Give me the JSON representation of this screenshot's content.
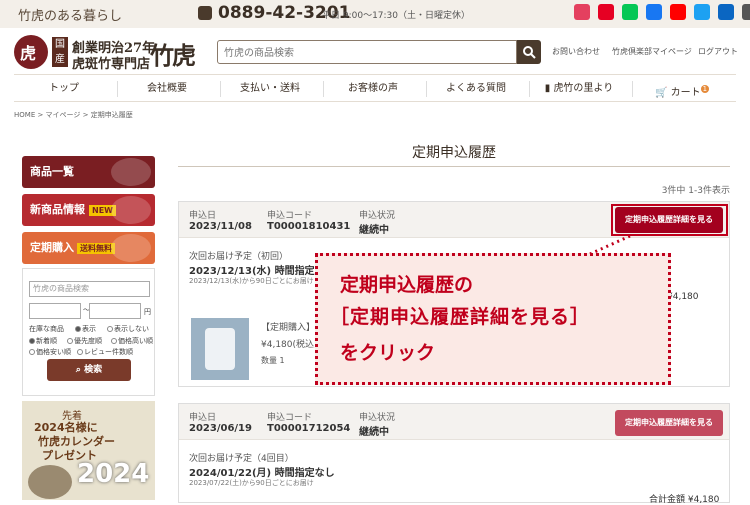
{
  "topbar": {
    "tagline": "竹虎のある暮らし",
    "phone": "0889-42-3201",
    "hours": "平日 9:00〜17:30（土・日曜定休）"
  },
  "sns": [
    {
      "name": "instagram-icon",
      "color": "#e4405f"
    },
    {
      "name": "pinterest-icon",
      "color": "#e60023"
    },
    {
      "name": "line-icon",
      "color": "#06c755"
    },
    {
      "name": "facebook-icon",
      "color": "#1877f2"
    },
    {
      "name": "youtube-icon",
      "color": "#ff0000"
    },
    {
      "name": "twitter-icon",
      "color": "#1da1f2"
    },
    {
      "name": "linkedin-icon",
      "color": "#0a66c2"
    },
    {
      "name": "mail-icon",
      "color": "#555555"
    }
  ],
  "logo": {
    "mark": "虎",
    "box": "国産",
    "line1": "創業明治27年",
    "line2": "虎斑竹専門店",
    "brush": "竹虎"
  },
  "search": {
    "placeholder": "竹虎の商品検索"
  },
  "header_links": {
    "contact": "お問い合わせ",
    "mypage": "竹虎倶楽部マイページ",
    "logout": "ログアウト"
  },
  "nav": {
    "items": [
      "トップ",
      "会社概要",
      "支払い・送料",
      "お客様の声",
      "よくある質問",
      "虎竹の里より",
      "カート"
    ],
    "cart_badge": "1"
  },
  "breadcrumb": "HOME > マイページ > 定期申込履歴",
  "sidebar": {
    "products": "商品一覧",
    "new_products": "新商品情報",
    "new_tag": "NEW",
    "subscription": "定期購入",
    "sale_tag": "送料無料",
    "search_placeholder": "竹虎の商品検索",
    "price_unit": "円",
    "stock_opts": [
      "在庫な商品",
      "表示",
      "表示しない"
    ],
    "sort_opts": [
      "新着順",
      "優先度順",
      "価格高い順",
      "価格安い順",
      "レビュー件数順"
    ],
    "search_button": "検索"
  },
  "promo": {
    "line1": "先着",
    "line2": "2024名様に",
    "line3": "竹虎カレンダー",
    "line4": "プレゼント",
    "year": "2024"
  },
  "main": {
    "title": "定期申込履歴",
    "count": "3件中 1-3件表示",
    "labels": {
      "date": "申込日",
      "code": "申込コード",
      "status": "申込状況",
      "next": "次回お届け予定"
    },
    "detail_button": "定期申込履歴詳細を見る",
    "orders": [
      {
        "date": "2023/11/08",
        "code": "T00001810431",
        "status": "継続中",
        "next_info": "（初回）",
        "next_date": "2023/12/13(水) 時間指定なし",
        "note": "2023/12/13(水)から90日ごとにお届け",
        "total": "¥4,180",
        "item_name": "【定期購入】",
        "item_price": "¥4,180(税込)",
        "qty": "数量 1"
      },
      {
        "date": "2023/06/19",
        "code": "T00001712054",
        "status": "継続中",
        "next_info": "（4回目）",
        "next_date": "2024/01/22(月) 時間指定なし",
        "note": "2023/07/22(土)から90日ごとにお届け",
        "total": "合計金額 ¥4,180"
      }
    ]
  },
  "callout": {
    "line1": "定期申込履歴の",
    "line2": "［定期申込履歴詳細を見る］",
    "line3": "をクリック"
  },
  "colors": {
    "brand": "#7a1e22",
    "button": "#a3001e",
    "button2": "#c24a5e",
    "callout": "#c0001c"
  }
}
